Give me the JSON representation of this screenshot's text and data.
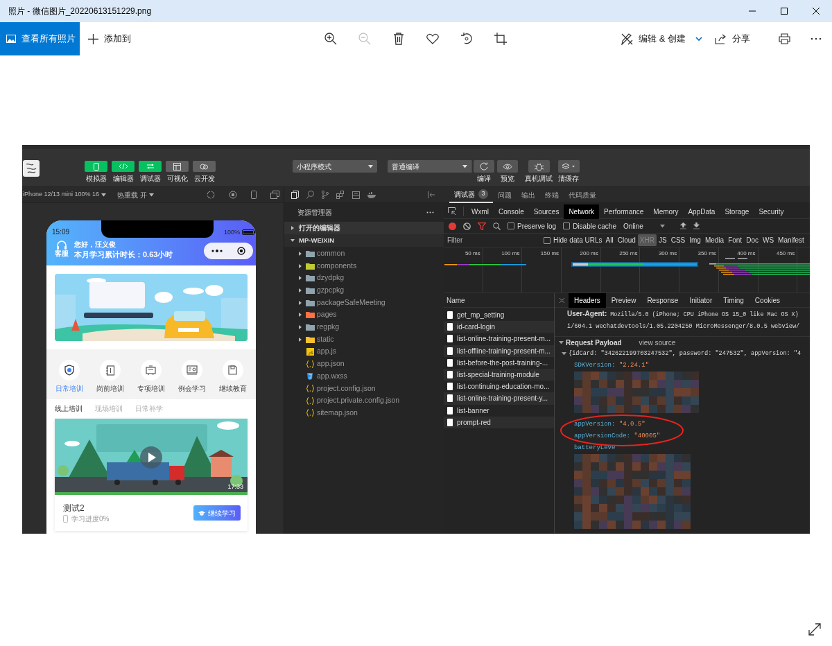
{
  "window": {
    "title": "照片 - 微信图片_20220613151229.png"
  },
  "toolbar": {
    "view_all": "查看所有照片",
    "add_to": "添加到",
    "tools": [
      {
        "kind": "zoom-in",
        "disabled": false
      },
      {
        "kind": "zoom-out",
        "disabled": true
      },
      {
        "kind": "delete",
        "disabled": false
      },
      {
        "kind": "favorite",
        "disabled": false
      },
      {
        "kind": "rotate",
        "disabled": false
      },
      {
        "kind": "crop",
        "disabled": false
      }
    ],
    "edit_create": "编辑 & 创建",
    "share": "分享"
  },
  "screenshot": {
    "ide_toolbar": {
      "view_buttons": [
        {
          "label": "模拟器",
          "kind": "phone",
          "on": true
        },
        {
          "label": "编辑器",
          "kind": "code",
          "on": true
        },
        {
          "label": "调试器",
          "kind": "debug",
          "on": true
        },
        {
          "label": "可视化",
          "kind": "layout",
          "on": false
        },
        {
          "label": "云开发",
          "kind": "cloud",
          "on": false
        }
      ],
      "mode": "小程序模式",
      "compile": "普通编译",
      "actions": [
        {
          "label": "编译",
          "kind": "compile"
        },
        {
          "label": "预览",
          "kind": "preview"
        },
        {
          "label": "真机调试",
          "kind": "bug"
        },
        {
          "label": "清缓存",
          "kind": "cache"
        }
      ]
    },
    "simulator": {
      "device": "iPhone 12/13 mini 100% 16",
      "hot_reload": "热重载 开",
      "phone": {
        "time": "15:09",
        "battery": "100%",
        "service": "客服",
        "greeting": "您好，汪义俊",
        "study_time": "本月学习累计时长：0.63小时",
        "categories": [
          {
            "label": "日常培训",
            "kind": "shield",
            "selected": true
          },
          {
            "label": "岗前培训",
            "kind": "book",
            "selected": false
          },
          {
            "label": "专项培训",
            "kind": "screen",
            "selected": false
          },
          {
            "label": "例会学习",
            "kind": "board",
            "selected": false
          },
          {
            "label": "继续教育",
            "kind": "save",
            "selected": false
          }
        ],
        "sub_tabs": [
          {
            "label": "线上培训",
            "selected": true
          },
          {
            "label": "现场培训",
            "selected": false
          },
          {
            "label": "日常补学",
            "selected": false
          }
        ],
        "course": {
          "duration": "17:33",
          "title": "测试2",
          "progress": "学习进度0%",
          "button": "继续学习"
        }
      }
    },
    "explorer": {
      "title": "资源管理器",
      "sections": [
        {
          "label": "打开的编辑器",
          "expanded": false
        },
        {
          "label": "MP-WEIXIN",
          "expanded": true,
          "children": [
            {
              "name": "common",
              "kind": "folder",
              "color": "#90a4ae",
              "expanded": false
            },
            {
              "name": "components",
              "kind": "folder",
              "color": "#c0ca33",
              "expanded": false
            },
            {
              "name": "dzydpkg",
              "kind": "folder",
              "color": "#90a4ae",
              "expanded": false
            },
            {
              "name": "gzpcpkg",
              "kind": "folder",
              "color": "#90a4ae",
              "expanded": false
            },
            {
              "name": "packageSafeMeeting",
              "kind": "folder",
              "color": "#90a4ae",
              "expanded": false
            },
            {
              "name": "pages",
              "kind": "folder",
              "color": "#ff7043",
              "expanded": false
            },
            {
              "name": "regpkg",
              "kind": "folder",
              "color": "#90a4ae",
              "expanded": false
            },
            {
              "name": "static",
              "kind": "folder",
              "color": "#fbc02d",
              "expanded": false
            },
            {
              "name": "app.js",
              "kind": "js"
            },
            {
              "name": "app.json",
              "kind": "json"
            },
            {
              "name": "app.wxss",
              "kind": "css"
            },
            {
              "name": "project.config.json",
              "kind": "json"
            },
            {
              "name": "project.private.config.json",
              "kind": "json"
            },
            {
              "name": "sitemap.json",
              "kind": "json"
            }
          ]
        }
      ]
    },
    "debugger": {
      "tabs": [
        {
          "label": "调试器",
          "badge": "3",
          "selected": true
        },
        {
          "label": "问题",
          "selected": false
        },
        {
          "label": "输出",
          "selected": false
        },
        {
          "label": "终端",
          "selected": false
        },
        {
          "label": "代码质量",
          "selected": false
        }
      ],
      "panel_tabs": [
        {
          "label": "Wxml",
          "selected": false
        },
        {
          "label": "Console",
          "selected": false
        },
        {
          "label": "Sources",
          "selected": false
        },
        {
          "label": "Network",
          "selected": true
        },
        {
          "label": "Performance",
          "selected": false
        },
        {
          "label": "Memory",
          "selected": false
        },
        {
          "label": "AppData",
          "selected": false
        },
        {
          "label": "Storage",
          "selected": false
        },
        {
          "label": "Security",
          "selected": false
        }
      ],
      "network": {
        "preserve_log": {
          "label": "Preserve log",
          "checked": false
        },
        "disable_cache": {
          "label": "Disable cache",
          "checked": false
        },
        "throttling": "Online",
        "filter_placeholder": "Filter",
        "hide_data_urls": {
          "label": "Hide data URLs",
          "checked": false
        },
        "types": [
          {
            "label": "All",
            "selected": false
          },
          {
            "label": "Cloud",
            "selected": false
          },
          {
            "label": "XHR",
            "selected": true
          },
          {
            "label": "JS",
            "selected": false
          },
          {
            "label": "CSS",
            "selected": false
          },
          {
            "label": "Img",
            "selected": false
          },
          {
            "label": "Media",
            "selected": false
          },
          {
            "label": "Font",
            "selected": false
          },
          {
            "label": "Doc",
            "selected": false
          },
          {
            "label": "WS",
            "selected": false
          },
          {
            "label": "Manifest",
            "selected": false
          }
        ],
        "timeline_ticks": [
          "50 ms",
          "100 ms",
          "150 ms",
          "200 ms",
          "250 ms",
          "300 ms",
          "350 ms",
          "400 ms",
          "450 ms"
        ],
        "name_header": "Name",
        "requests": [
          "get_mp_setting",
          "id-card-login",
          "list-online-training-present-m...",
          "list-offline-training-present-m...",
          "list-before-the-post-training-...",
          "list-special-training-module",
          "list-continuing-education-mo...",
          "list-online-training-present-y...",
          "list-banner",
          "prompt-red"
        ],
        "detail_tabs": [
          {
            "label": "Headers",
            "selected": true
          },
          {
            "label": "Preview",
            "selected": false
          },
          {
            "label": "Response",
            "selected": false
          },
          {
            "label": "Initiator",
            "selected": false
          },
          {
            "label": "Timing",
            "selected": false
          },
          {
            "label": "Cookies",
            "selected": false
          }
        ],
        "user_agent_label": "User-Agent:",
        "user_agent_value": "Mozilla/5.0 (iPhone; CPU iPhone OS 15_0 like Mac OS X)",
        "user_agent_more": "i/604.1 wechatdevtools/1.05.2204250 MicroMessenger/8.0.5 webview/",
        "payload": {
          "title": "Request Payload",
          "view_source": "view source",
          "summary": "{idCard: \"342622199703247532\", password: \"247532\", appVersion: \"4",
          "first": {
            "key": "SDKVersion:",
            "value": "\"2.24.1\""
          },
          "circled": [
            {
              "key": "appVersion:",
              "value": "\"4.0.5\""
            },
            {
              "key": "appVersionCode:",
              "value": "\"40005\""
            }
          ],
          "last_key": "batteryLeve"
        }
      }
    }
  }
}
